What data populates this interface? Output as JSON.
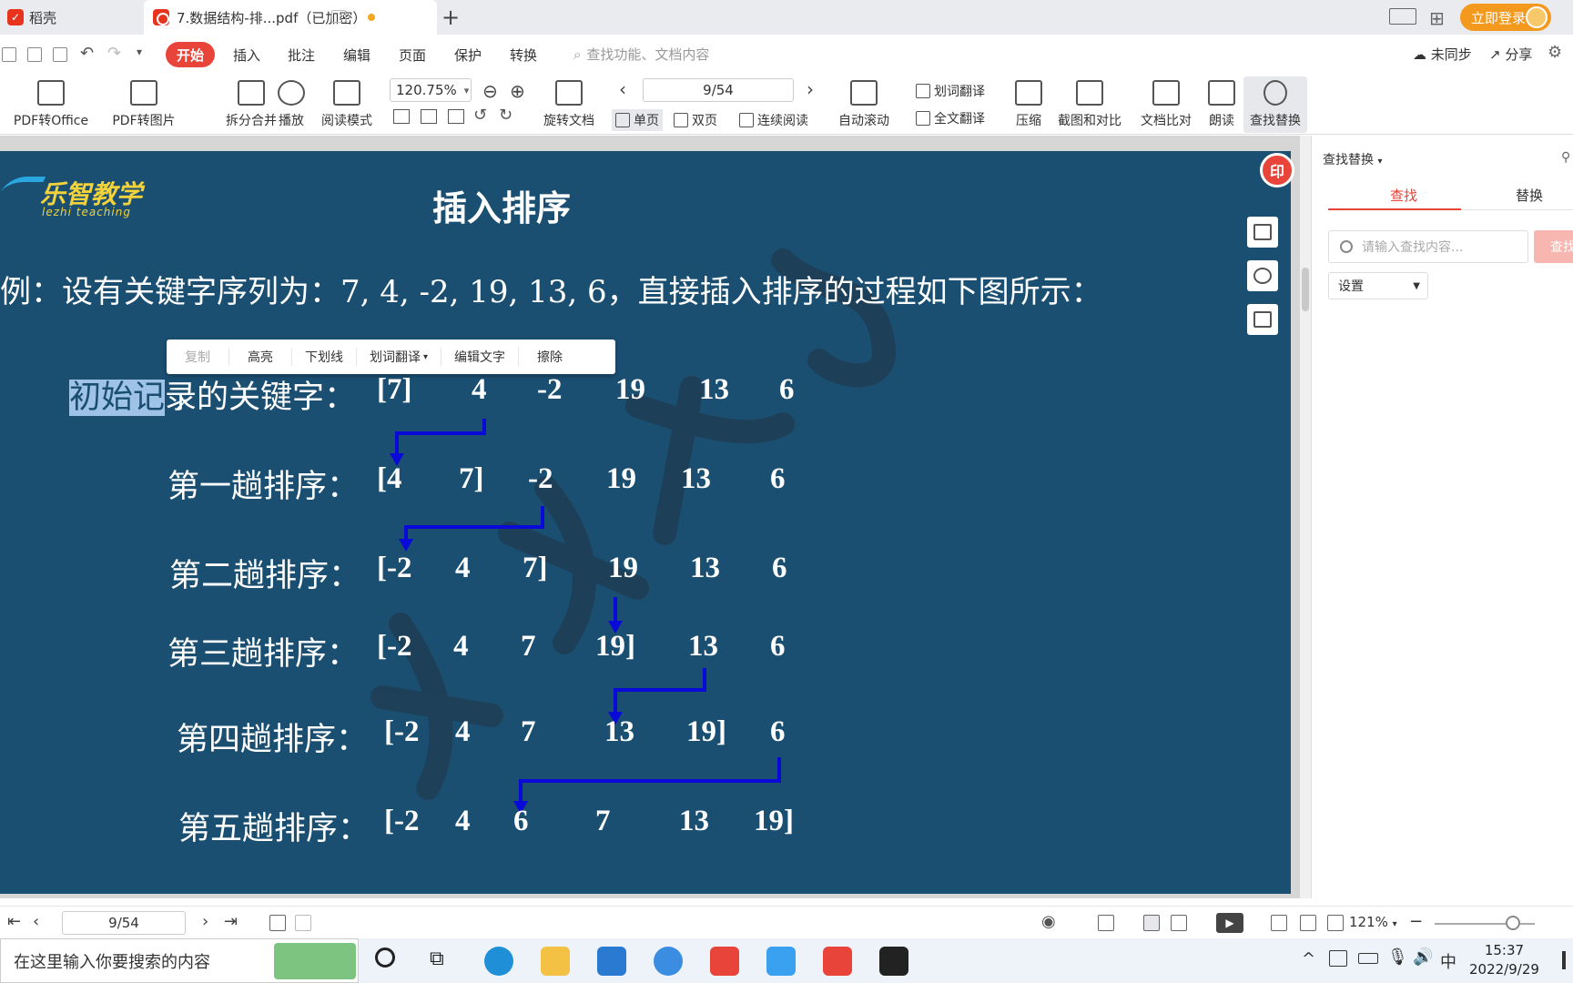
{
  "tabs": {
    "home_label": "稻壳",
    "doc_label": "7.数据结构-排...pdf（已加密）",
    "login_label": "立即登录"
  },
  "menu": {
    "start": "开始",
    "items": [
      "插入",
      "批注",
      "编辑",
      "页面",
      "保护",
      "转换"
    ],
    "search_placeholder": "查找功能、文档内容",
    "sync": "未同步",
    "share": "分享"
  },
  "ribbon": {
    "pdf_to_office": "PDF转Office",
    "pdf_to_image": "PDF转图片",
    "split_merge": "拆分合并",
    "play": "播放",
    "read_mode": "阅读模式",
    "zoom": "120.75%",
    "rotate": "旋转文档",
    "page": "9/54",
    "single_page": "单页",
    "double_page": "双页",
    "continuous": "连续阅读",
    "auto_scroll": "自动滚动",
    "word_translate": "划词翻译",
    "full_translate": "全文翻译",
    "compress": "压缩",
    "screenshot_compare": "截图和对比",
    "doc_compare": "文档比对",
    "read_aloud": "朗读",
    "find_replace": "查找替换"
  },
  "slide": {
    "logo": "乐智教学",
    "logo_sub": "lezhi teaching",
    "title": "插入排序",
    "intro": "例：设有关键字序列为：7, 4, -2, 19, 13, 6，直接插入排序的过程如下图所示：",
    "rows": [
      {
        "label_hl": "初始记",
        "label_rest": "录的关键字：",
        "cells": [
          "[7]",
          "4",
          "-2",
          "19",
          "13",
          "6"
        ]
      },
      {
        "label": "第一趟排序：",
        "cells": [
          "[4",
          "7]",
          "-2",
          "19",
          "13",
          "6"
        ]
      },
      {
        "label": "第二趟排序：",
        "cells": [
          "[-2",
          "4",
          "7]",
          "19",
          "13",
          "6"
        ]
      },
      {
        "label": "第三趟排序：",
        "cells": [
          "[-2",
          "4",
          "7",
          "19]",
          "13",
          "6"
        ]
      },
      {
        "label": "第四趟排序：",
        "cells": [
          "[-2",
          "4",
          "7",
          "13",
          "19]",
          "6"
        ]
      },
      {
        "label": "第五趟排序：",
        "cells": [
          "[-2",
          "4",
          "6",
          "7",
          "13",
          "19]"
        ]
      }
    ],
    "stamp": "印"
  },
  "selection_toolbar": [
    "复制",
    "高亮",
    "下划线",
    "划词翻译",
    "编辑文字",
    "擦除"
  ],
  "right_panel": {
    "title": "查找替换",
    "tab_find": "查找",
    "tab_replace": "替换",
    "input_placeholder": "请输入查找内容...",
    "find_button": "查找",
    "settings": "设置"
  },
  "status": {
    "page": "9/54",
    "zoom": "121%"
  },
  "taskbar": {
    "search_placeholder": "在这里输入你要搜索的内容",
    "time": "15:37",
    "date": "2022/9/29",
    "ime": "中"
  },
  "colors": {
    "slide_bg": "#1a4f72",
    "accent": "#e8443a",
    "arrow": "#0a0ad8"
  }
}
